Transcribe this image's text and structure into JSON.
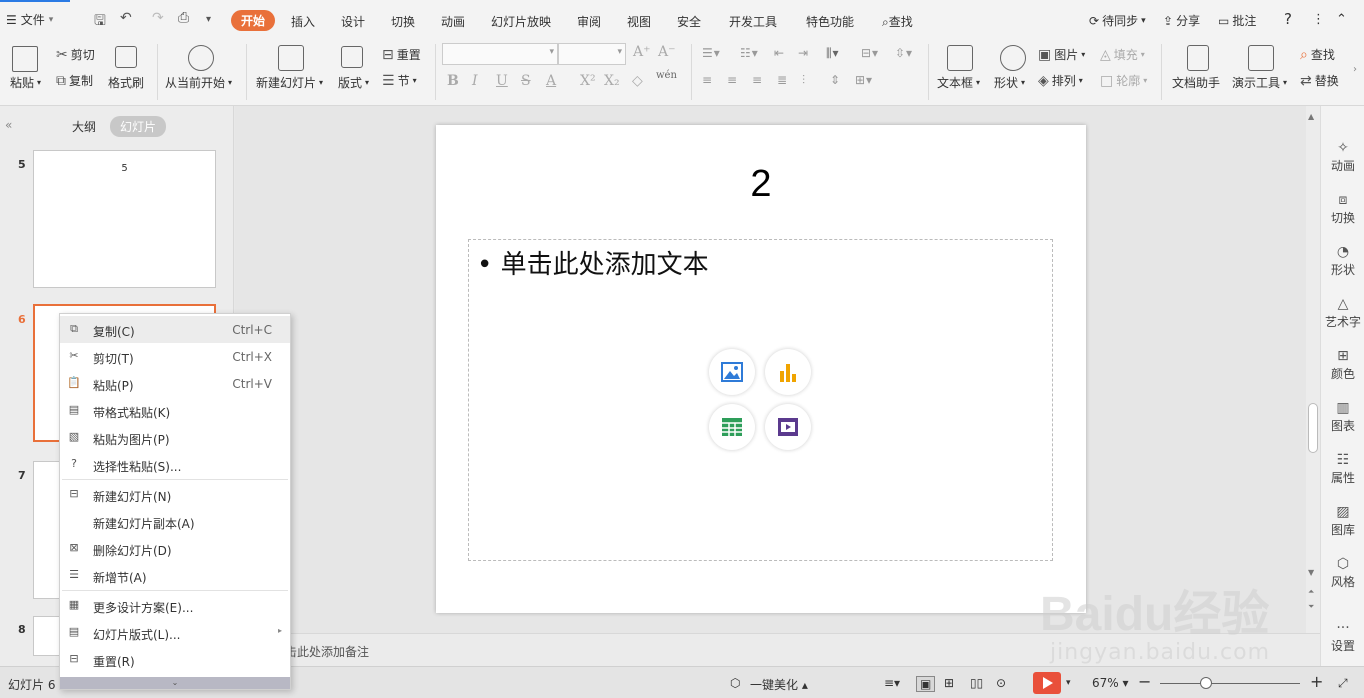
{
  "menubar": {
    "file_label": "文件",
    "tabs": [
      "开始",
      "插入",
      "设计",
      "切换",
      "动画",
      "幻灯片放映",
      "审阅",
      "视图",
      "安全",
      "开发工具",
      "特色功能"
    ],
    "search_label": "查找",
    "sync_label": "待同步",
    "share_label": "分享",
    "comment_label": "批注",
    "help_label": "?"
  },
  "ribbon": {
    "paste": "粘贴",
    "cut": "剪切",
    "copy": "复制",
    "format_painter": "格式刷",
    "from_current": "从当前开始",
    "new_slide": "新建幻灯片",
    "layout": "版式",
    "reset": "重置",
    "section": "节",
    "text_box": "文本框",
    "shape": "形状",
    "picture": "图片",
    "fill": "填充",
    "arrange": "排列",
    "outline": "轮廓",
    "doc_assistant": "文档助手",
    "present_tools": "演示工具",
    "find": "查找",
    "replace": "替换",
    "phonetic": "wén"
  },
  "left_panel": {
    "outline_tab": "大纲",
    "slides_tab": "幻灯片",
    "slides": [
      {
        "number": "5",
        "title": "5"
      },
      {
        "number": "6",
        "title": ""
      },
      {
        "number": "7",
        "title": ""
      },
      {
        "number": "8",
        "title": ""
      }
    ]
  },
  "context_menu": {
    "items": [
      {
        "label": "复制(C)",
        "shortcut": "Ctrl+C",
        "icon": "copy-icon"
      },
      {
        "label": "剪切(T)",
        "shortcut": "Ctrl+X",
        "icon": "cut-icon"
      },
      {
        "label": "粘贴(P)",
        "shortcut": "Ctrl+V",
        "icon": "paste-icon"
      },
      {
        "label": "带格式粘贴(K)",
        "shortcut": "",
        "icon": "paste-format-icon"
      },
      {
        "label": "粘贴为图片(P)",
        "shortcut": "",
        "icon": "paste-picture-icon"
      },
      {
        "label": "选择性粘贴(S)...",
        "shortcut": "",
        "icon": "paste-special-icon"
      },
      {
        "label": "新建幻灯片(N)",
        "shortcut": "",
        "icon": "new-slide-icon"
      },
      {
        "label": "新建幻灯片副本(A)",
        "shortcut": "",
        "icon": ""
      },
      {
        "label": "删除幻灯片(D)",
        "shortcut": "",
        "icon": "delete-slide-icon"
      },
      {
        "label": "新增节(A)",
        "shortcut": "",
        "icon": "new-section-icon"
      },
      {
        "label": "更多设计方案(E)...",
        "shortcut": "",
        "icon": "design-icon"
      },
      {
        "label": "幻灯片版式(L)...",
        "shortcut": "",
        "icon": "layout-icon"
      },
      {
        "label": "重置(R)",
        "shortcut": "",
        "icon": "reset-icon"
      }
    ]
  },
  "slide": {
    "title": "2",
    "placeholder_text": "单击此处添加文本"
  },
  "sidebar": {
    "items": [
      "动画",
      "切换",
      "形状",
      "艺术字",
      "颜色",
      "图表",
      "属性",
      "图库",
      "风格",
      "设置"
    ]
  },
  "notes": {
    "placeholder": "击此处添加备注"
  },
  "statusbar": {
    "slide_info": "幻灯片 6",
    "beautify": "一键美化",
    "zoom": "67%"
  },
  "watermark": {
    "brand": "Baidu经验",
    "url": "jingyan.baidu.com"
  },
  "colors": {
    "accent": "#e9703a",
    "play": "#e9503a"
  }
}
